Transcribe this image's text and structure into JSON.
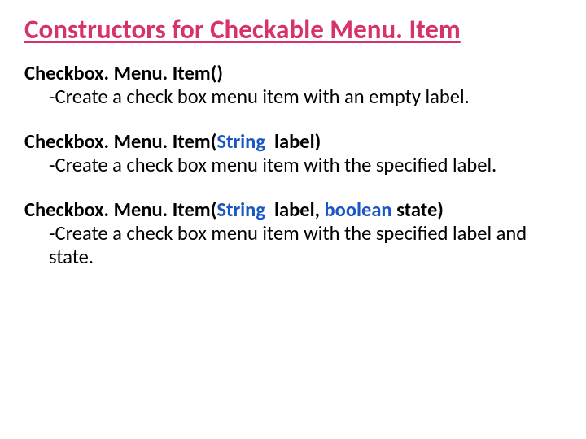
{
  "title": "Constructors for Checkable Menu. Item",
  "entries": [
    {
      "sig_pre": "Checkbox. Menu. Item()",
      "type1": "",
      "mid1": "",
      "type2": "",
      "sig_post": "",
      "desc": "-Create a check box menu item with an empty label."
    },
    {
      "sig_pre": "Checkbox. Menu. Item(",
      "type1": "String",
      "mid1": "  label)",
      "type2": "",
      "sig_post": "",
      "desc": "-Create a check box menu item with the specified label."
    },
    {
      "sig_pre": "Checkbox. Menu. Item(",
      "type1": "String",
      "mid1": "  label, ",
      "type2": "boolean",
      "sig_post": " state)",
      "desc": "-Create a check box menu item with the specified label and state."
    }
  ]
}
